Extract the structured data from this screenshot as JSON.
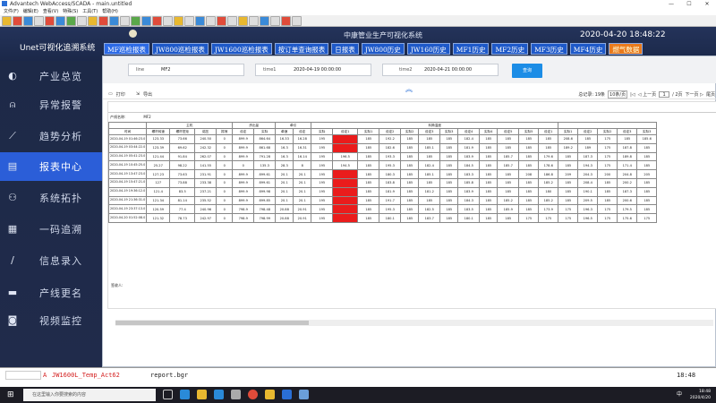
{
  "window": {
    "title": "Advantech WebAccess/SCADA - main.untitled",
    "controls": [
      "—",
      "☐",
      "✕"
    ]
  },
  "menu": [
    "文件(F)",
    "编辑(E)",
    "查看(V)",
    "特殊(S)",
    "工具(T)",
    "帮助(H)"
  ],
  "toolbar_icon_count": 28,
  "header": {
    "app_title": "Unet可视化追溯系统",
    "system_title": "中康管业生产可视化系统",
    "datetime": "2020-04-20  18:48:22"
  },
  "tabs": [
    {
      "label": "MF巡检报表",
      "state": "active"
    },
    {
      "label": "JW800巡检报表",
      "state": "normal"
    },
    {
      "label": "JW1600巡检报表",
      "state": "normal"
    },
    {
      "label": "按订单查询报表",
      "state": "normal"
    },
    {
      "label": "日报表",
      "state": "normal"
    },
    {
      "label": "JW800历史",
      "state": "normal"
    },
    {
      "label": "JW160历史",
      "state": "normal"
    },
    {
      "label": "MF1历史",
      "state": "normal"
    },
    {
      "label": "MF2历史",
      "state": "normal"
    },
    {
      "label": "MF3历史",
      "state": "normal"
    },
    {
      "label": "MF4历史",
      "state": "normal"
    },
    {
      "label": "燃气数据",
      "state": "alert"
    }
  ],
  "sidebar": [
    {
      "label": "产业总览",
      "icon": "dashboard-icon",
      "glyph": "◐"
    },
    {
      "label": "异常报警",
      "icon": "bell-icon",
      "glyph": "⍝"
    },
    {
      "label": "趋势分析",
      "icon": "trend-chart-icon",
      "glyph": "⟋"
    },
    {
      "label": "报表中心",
      "icon": "document-icon",
      "glyph": "▤",
      "active": true
    },
    {
      "label": "系统拓扑",
      "icon": "topology-icon",
      "glyph": "⚇"
    },
    {
      "label": "一码追溯",
      "icon": "qrcode-icon",
      "glyph": "▦"
    },
    {
      "label": "信息录入",
      "icon": "pen-icon",
      "glyph": "∕"
    },
    {
      "label": "产线更名",
      "icon": "production-line-icon",
      "glyph": "▬"
    },
    {
      "label": "视频监控",
      "icon": "camera-icon",
      "glyph": "◙"
    }
  ],
  "filters": {
    "line_label": "line",
    "line_value": "MF2",
    "time1_label": "time1",
    "time1_value": "2020-04-19 00:00:00",
    "time2_label": "time2",
    "time2_value": "2020-04-21 00:00:00",
    "query_button": "查询"
  },
  "report_toolbar": {
    "print": "打印",
    "export": "导出",
    "total": "总记录: 19条",
    "per_page": "10条/页",
    "first": "|◁",
    "prev": "◁ 上一页",
    "page_input": "1",
    "page_of": "/ 2页",
    "next": "下一页 ▷",
    "last": "尾页"
  },
  "report": {
    "product_label": "产线名称:",
    "product_value": "MF2",
    "group_headers": [
      "主机",
      "挤出量",
      "牵引",
      "料筒温度"
    ],
    "columns": [
      "时间",
      "螺杆转速",
      "螺杆扭矩",
      "熔压",
      "振荡",
      "设定",
      "实际",
      "牵速",
      "设定",
      "实际",
      "设定1",
      "实际1",
      "设定2",
      "实际2",
      "设定3",
      "实际3",
      "设定4",
      "实际4",
      "设定5",
      "实际5",
      "设定1",
      "实际1",
      "设定2",
      "实际2",
      "设定3",
      "实际3"
    ],
    "rows": [
      [
        "2020-04-19 01:46:23.0",
        "123.33",
        "73.66",
        "240.50",
        "0",
        "899.9",
        "864.64",
        "16.33",
        "16.28",
        "195",
        "",
        "185",
        "192.2",
        "185",
        "185",
        "185",
        "182.4",
        "185",
        "185",
        "185",
        "185",
        "208.6",
        "185",
        "175",
        "185",
        "185.6"
      ],
      [
        "2020-04-19 03:44:22.0",
        "123.39",
        "69.62",
        "242.32",
        "0",
        "899.9",
        "861.68",
        "16.3",
        "16.31",
        "195",
        "",
        "185",
        "182.6",
        "185",
        "185.1",
        "185",
        "181.9",
        "185",
        "185",
        "185",
        "185",
        "189.2",
        "189",
        "175",
        "187.8",
        "185"
      ],
      [
        "2020-04-19 05:41:23.0",
        "121.44",
        "91.84",
        "262.07",
        "0",
        "899.9",
        "791.28",
        "16.3",
        "16.14",
        "195",
        "196.5",
        "185",
        "193.3",
        "185",
        "185",
        "185",
        "183.9",
        "185",
        "185.7",
        "185",
        "179.6",
        "185",
        "187.3",
        "175",
        "189.8",
        "185"
      ],
      [
        "2020-04-19 10:45:25.0",
        "25.27",
        "98.22",
        "141.55",
        "0",
        "0",
        "135.3",
        "28.3",
        "8",
        "195",
        "194.5",
        "185",
        "195.3",
        "185",
        "182.4",
        "185",
        "184.5",
        "185",
        "185.7",
        "185",
        "178.6",
        "185",
        "194.3",
        "175",
        "171.4",
        "185"
      ],
      [
        "2020-04-19 13:47:23.0",
        "127.23",
        "73.63",
        "231.91",
        "0",
        "899.9",
        "899.61",
        "20.1",
        "20.1",
        "195",
        "",
        "185",
        "180.3",
        "185",
        "185.1",
        "185",
        "183.3",
        "185",
        "185",
        "208",
        "186.8",
        "209",
        "204.3",
        "200",
        "204.8",
        "205"
      ],
      [
        "2020-04-19 15:47:21.0",
        "127",
        "73.88",
        "233.38",
        "0",
        "899.9",
        "899.61",
        "20.1",
        "20.1",
        "195",
        "",
        "185",
        "183.8",
        "185",
        "185",
        "185",
        "185.8",
        "185",
        "185",
        "185",
        "185.2",
        "185",
        "208.4",
        "185",
        "200.2",
        "185"
      ],
      [
        "2020-04-19 19:36:12.0",
        "121.4",
        "83.5",
        "237.21",
        "0",
        "899.9",
        "899.98",
        "20.1",
        "20.1",
        "195",
        "",
        "185",
        "181.9",
        "185",
        "181.2",
        "185",
        "183.9",
        "185",
        "185",
        "185",
        "180",
        "185",
        "190.1",
        "185",
        "187.3",
        "185"
      ],
      [
        "2020-04-19 21:36:31.0",
        "121.34",
        "81.14",
        "235.52",
        "0",
        "899.9",
        "899.85",
        "20.1",
        "20.1",
        "195",
        "",
        "185",
        "191.7",
        "185",
        "185",
        "185",
        "184.3",
        "185",
        "185.2",
        "185",
        "185.2",
        "185",
        "209.5",
        "185",
        "200.6",
        "185"
      ],
      [
        "2020-04-19 23:37:13.0",
        "120.59",
        "77.4",
        "240.96",
        "0",
        "798.9",
        "798.48",
        "20.88",
        "20.91",
        "195",
        "",
        "185",
        "195.3",
        "185",
        "182.5",
        "185",
        "183.5",
        "185",
        "185.9",
        "185",
        "173.9",
        "175",
        "196.3",
        "175",
        "179.5",
        "185"
      ],
      [
        "2020-04-20 01:52:08.0",
        "121.32",
        "78.73",
        "242.97",
        "0",
        "798.9",
        "798.99",
        "20.88",
        "20.91",
        "195",
        "",
        "185",
        "180.1",
        "185",
        "183.7",
        "185",
        "180.1",
        "185",
        "185",
        "175",
        "175",
        "175",
        "196.5",
        "175",
        "175.6",
        "175"
      ]
    ],
    "signer_label": "签收人:"
  },
  "status": {
    "left_marker": "A",
    "tag": "JW1600L_Temp_Act62",
    "file": "report.bgr",
    "right_time": "18:48"
  },
  "taskbar": {
    "search_placeholder": "在这里输入你要搜索的内容",
    "clock": "18:48",
    "date": "2020/4/20",
    "lang": "中"
  },
  "colors": {
    "accent": "#2c6ae6",
    "alert_tab": "#e97a1c",
    "red_cell": "#ea1c1c",
    "sidebar_active": "#2b5ed8"
  }
}
